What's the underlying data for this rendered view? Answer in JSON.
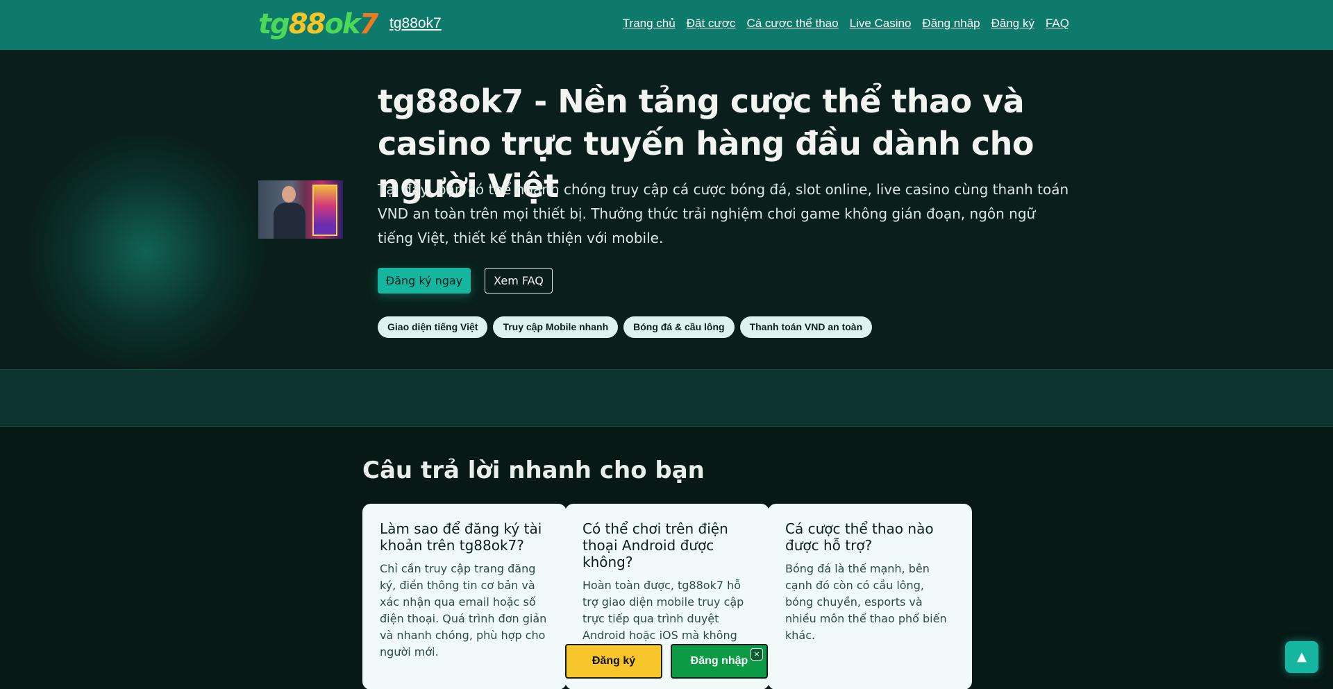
{
  "header": {
    "logo_parts": [
      "tg",
      "88",
      "ok",
      "7"
    ],
    "site_name": "tg88ok7",
    "nav": [
      "Trang chủ",
      "Đặt cược",
      "Cá cược thể thao",
      "Live Casino",
      "Đăng nhập",
      "Đăng ký",
      "FAQ"
    ]
  },
  "hero": {
    "title": "tg88ok7 - Nền tảng cược thể thao và casino trực tuyến hàng đầu dành cho người Việt",
    "description": "Tại đây, bạn có thể nhanh chóng truy cập cá cược bóng đá, slot online, live casino cùng thanh toán VND an toàn trên mọi thiết bị. Thưởng thức trải nghiệm chơi game không gián đoạn, ngôn ngữ tiếng Việt, thiết kế thân thiện với mobile.",
    "primary_button": "Đăng ký ngay",
    "secondary_button": "Xem FAQ",
    "tags": [
      "Giao diện tiếng Việt",
      "Truy cập Mobile nhanh",
      "Bóng đá & cầu lông",
      "Thanh toán VND an toàn"
    ]
  },
  "faq": {
    "title": "Câu trả lời nhanh cho bạn",
    "cards": [
      {
        "question": "Làm sao để đăng ký tài khoản trên tg88ok7?",
        "answer": "Chỉ cần truy cập trang đăng ký, điền thông tin cơ bản và xác nhận qua email hoặc số điện thoại. Quá trình đơn giản và nhanh chóng, phù hợp cho người mới."
      },
      {
        "question": "Có thể chơi trên điện thoại Android được không?",
        "answer": "Hoàn toàn được, tg88ok7 hỗ trợ giao diện mobile truy cập trực tiếp qua trình duyệt Android hoặc iOS mà không cần tải app."
      },
      {
        "question": "Cá cược thể thao nào được hỗ trợ?",
        "answer": "Bóng đá là thế mạnh, bên cạnh đó còn có cầu lông, bóng chuyền, esports và nhiều môn thể thao phổ biến khác."
      }
    ]
  },
  "floating": {
    "register": "Đăng ký",
    "login": "Đăng nhập",
    "close": "×",
    "back_to_top": "▲"
  },
  "colors": {
    "header_bg": "#0e7a6c",
    "accent": "#16b5a0",
    "register_yellow": "#f7c62b",
    "login_green": "#0d9a45",
    "page_bg": "#071815"
  }
}
